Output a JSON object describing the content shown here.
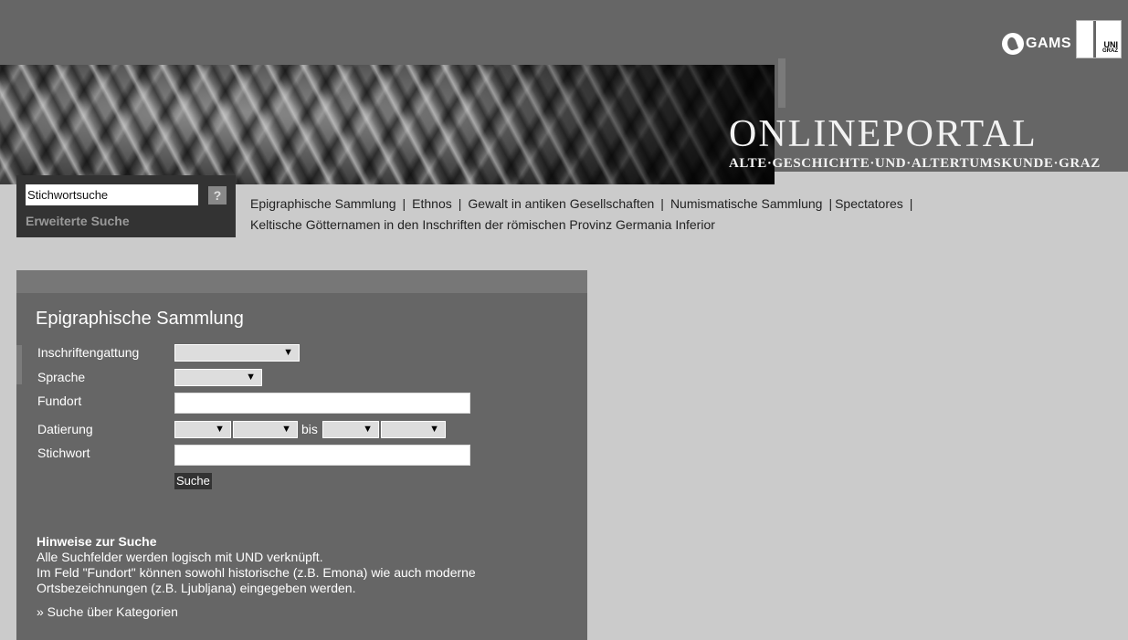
{
  "header": {
    "brand_title": "ONLINEPORTAL",
    "brand_subtitle": "ALTE·GESCHICHTE·UND·ALTERTUMSKUNDE·GRAZ",
    "gams_label": "GAMS",
    "uni_label_1": "UNI",
    "uni_label_2": "GRAZ"
  },
  "search": {
    "value": "Stichwortsuche",
    "help_label": "?",
    "advanced_label": "Erweiterte Suche"
  },
  "topnav": {
    "items": [
      "Epigraphische Sammlung",
      "Ethnos",
      "Gewalt in antiken Gesellschaften",
      "Numismatische Sammlung",
      "Spectatores",
      "Keltische Götternamen in den Inschriften der römischen Provinz Germania Inferior"
    ],
    "separator": "|"
  },
  "form": {
    "title": "Epigraphische Sammlung",
    "labels": {
      "inschriftengattung": "Inschriftengattung",
      "sprache": "Sprache",
      "fundort": "Fundort",
      "datierung": "Datierung",
      "stichwort": "Stichwort"
    },
    "bis": "bis",
    "arrow": "▼",
    "submit_label": "Suche"
  },
  "hints": {
    "heading": "Hinweise zur Suche",
    "line1": "Alle Suchfelder werden logisch mit UND verknüpft.",
    "line2": "Im Feld \"Fundort\" können sowohl historische (z.B. Emona) wie auch moderne Ortsbezeichnungen (z.B. Ljubljana) eingegeben werden.",
    "category_link": "» Suche über Kategorien"
  }
}
